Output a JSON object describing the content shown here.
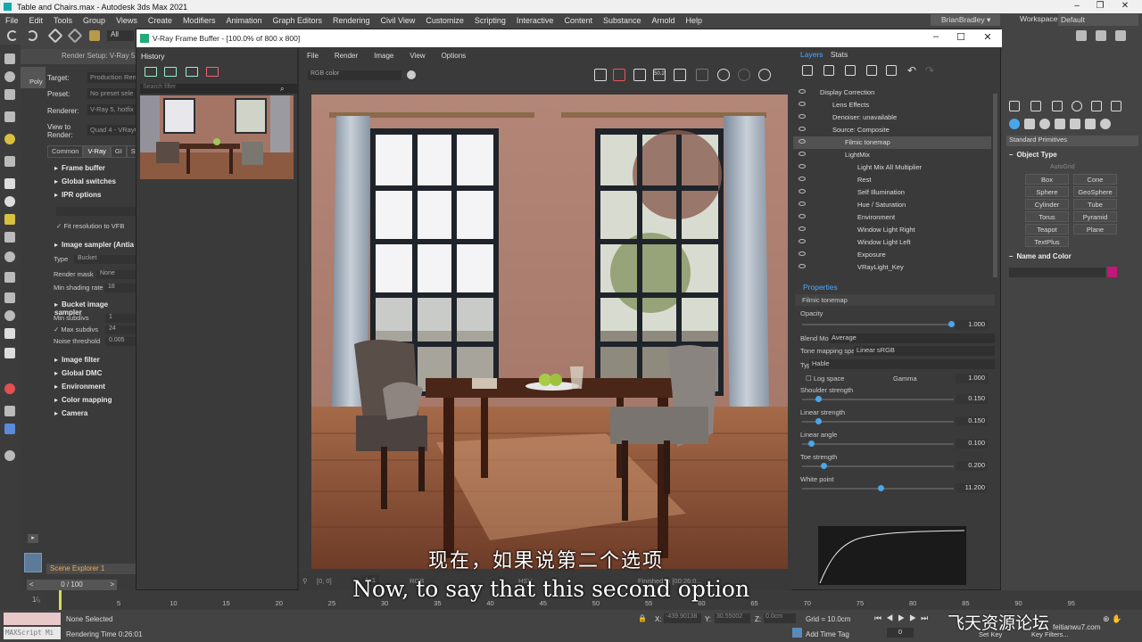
{
  "app": {
    "title": "Table and Chairs.max - Autodesk 3ds Max 2021",
    "menus": [
      "File",
      "Edit",
      "Tools",
      "Group",
      "Views",
      "Create",
      "Modifiers",
      "Animation",
      "Graph Editors",
      "Rendering",
      "Civil View",
      "Customize",
      "Scripting",
      "Interactive",
      "Content",
      "Substance",
      "Arnold",
      "Help"
    ],
    "user": "BrianBradley",
    "workspaces_label": "Workspaces:",
    "workspace": "Default",
    "toolbar_all": "All"
  },
  "render_setup": {
    "title": "Render Setup: V-Ray 5",
    "target_label": "Target:",
    "target": "Production Ren",
    "preset_label": "Preset:",
    "preset": "No preset sele",
    "renderer_label": "Renderer:",
    "renderer": "V-Ray 5, hotfix",
    "view_label": "View to Render:",
    "view": "Quad 4 - VRayC",
    "tabs": [
      "Common",
      "V-Ray",
      "GI",
      "S"
    ],
    "sections": [
      "Frame buffer",
      "Global switches",
      "IPR options"
    ],
    "fit_vfb": "Fit resolution to VFB",
    "sampler_sec": "Image sampler (Antia",
    "type_label": "Type",
    "type_val": "Bucket",
    "render_mask_label": "Render mask",
    "render_mask_val": "None",
    "min_shading_label": "Min shading rate",
    "min_shading_val": "18",
    "bucket_sec": "Bucket image sampler",
    "min_subdivs_label": "Min subdivs",
    "min_subdivs_val": "1",
    "max_subdivs_label": "Max subdivs",
    "max_subdivs_val": "24",
    "noise_label": "Noise threshold",
    "noise_val": "0.005",
    "more_sections": [
      "Image filter",
      "Global DMC",
      "Environment",
      "Color mapping",
      "Camera"
    ]
  },
  "vfb": {
    "title": "V-Ray Frame Buffer - [100.0% of 800 x 800]",
    "history_label": "History",
    "search_placeholder": "Search filter",
    "menus": [
      "File",
      "Render",
      "Image",
      "View",
      "Options"
    ],
    "channel": "RGB color",
    "zoom_btn": "50.2",
    "status_coord": "[0, 0]",
    "status_ratio": "1x1",
    "status_rgb": "RGB",
    "status_hsv": "HSV",
    "status_done": "Finished in [00:26:0..."
  },
  "layers": {
    "tabs": [
      "Layers",
      "Stats"
    ],
    "items": [
      {
        "name": "Display Correction",
        "indent": 0
      },
      {
        "name": "Lens Effects",
        "indent": 1
      },
      {
        "name": "Denoiser: unavailable",
        "indent": 1
      },
      {
        "name": "Source: Composite",
        "indent": 1
      },
      {
        "name": "Filmic tonemap",
        "indent": 2,
        "selected": true
      },
      {
        "name": "LightMix",
        "indent": 2
      },
      {
        "name": "Light Mix All Multiplier",
        "indent": 3
      },
      {
        "name": "Rest",
        "indent": 3
      },
      {
        "name": "Self Illumination",
        "indent": 3
      },
      {
        "name": "Hue / Saturation",
        "indent": 3
      },
      {
        "name": "Environment",
        "indent": 3
      },
      {
        "name": "Window Light Right",
        "indent": 3
      },
      {
        "name": "Window Light Left",
        "indent": 3
      },
      {
        "name": "Exposure",
        "indent": 3
      },
      {
        "name": "VRayLight_Key",
        "indent": 3
      }
    ]
  },
  "properties": {
    "header": "Properties",
    "name": "Filmic tonemap",
    "opacity_label": "Opacity",
    "opacity": "1.000",
    "opacity_frac": 1.0,
    "blend_label": "Blend Mode",
    "blend": "Average",
    "tonemap_space_label": "Tone mapping space",
    "tonemap_space": "Linear sRGB",
    "type_label": "Type",
    "type": "Hable",
    "logspace_label": "Log space",
    "gamma_label": "Gamma",
    "gamma": "1.000",
    "params": [
      {
        "label": "Shoulder strength",
        "value": "0.150",
        "frac": 0.09
      },
      {
        "label": "Linear strength",
        "value": "0.150",
        "frac": 0.09
      },
      {
        "label": "Linear angle",
        "value": "0.100",
        "frac": 0.04
      },
      {
        "label": "Toe strength",
        "value": "0.200",
        "frac": 0.13
      },
      {
        "label": "White point",
        "value": "11.200",
        "frac": 0.52
      }
    ]
  },
  "command_panel": {
    "dropdown": "Standard Primitives",
    "object_type": "Object Type",
    "autogrid": "AutoGrid",
    "primitives": [
      "Box",
      "Cone",
      "Sphere",
      "GeoSphere",
      "Cylinder",
      "Tube",
      "Torus",
      "Pyramid",
      "Teapot",
      "Plane",
      "TextPlus"
    ],
    "name_color": "Name and Color",
    "swatch_color": "#c2187a"
  },
  "timeline": {
    "frame": "0 / 100",
    "ticks": [
      "5",
      "10",
      "15",
      "20",
      "25",
      "30",
      "35",
      "40",
      "45",
      "50",
      "55",
      "60",
      "65",
      "70",
      "75",
      "80",
      "85",
      "90",
      "95"
    ]
  },
  "status": {
    "scene_explorer": "Scene Explorer 1",
    "maxscript": "MAXScript Mi",
    "none_selected": "None Selected",
    "rendering_time": "Rendering Time 0:26:01",
    "x_label": "X:",
    "x_val": "-439.90138",
    "y_label": "Y:",
    "y_val": "30.55002",
    "z_label": "Z:",
    "z_val": "0.0cm",
    "grid": "Grid = 10.0cm",
    "add_time_tag": "Add Time Tag",
    "set_key": "Set Key",
    "key_filters": "Key Filters...",
    "frame_num": "0"
  },
  "subtitles": {
    "cn": "现在，如果说第二个选项",
    "en": "Now, to say that this second option"
  },
  "watermark": {
    "cn": "飞天资源论坛",
    "url": "feitianwu7.com"
  }
}
